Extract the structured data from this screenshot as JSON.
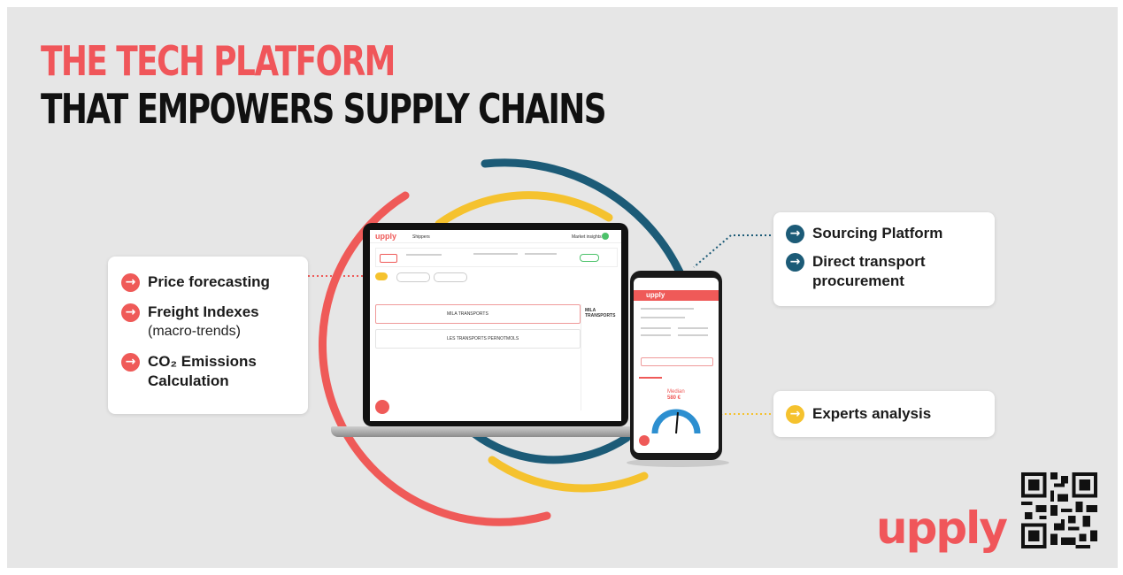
{
  "header": {
    "title_line1": "THE TECH PLATFORM",
    "title_line2": "THAT EMPOWERS SUPPLY CHAINS"
  },
  "left_card": {
    "items": [
      {
        "label": "Price forecasting",
        "sub": ""
      },
      {
        "label": "Freight Indexes",
        "sub": "(macro-trends)"
      },
      {
        "label": "CO₂ Emissions",
        "sub": "Calculation"
      }
    ]
  },
  "right_top_card": {
    "items": [
      {
        "label": "Sourcing Platform"
      },
      {
        "label": "Direct transport procurement"
      }
    ]
  },
  "right_bottom_card": {
    "items": [
      {
        "label": "Experts analysis"
      }
    ]
  },
  "laptop": {
    "logo": "upply",
    "tab": "Shippers",
    "menu": "Market insights",
    "offer_company_1": "MILA TRANSPORTS",
    "offer_company_2": "LES TRANSPORTS PERNOTMOLS",
    "detail_title": "MILA TRANSPORTS"
  },
  "phone": {
    "logo": "upply",
    "gauge_label": "Median",
    "gauge_value": "580 €"
  },
  "brand": {
    "logo": "upply"
  },
  "colors": {
    "accent_red": "#f0565a",
    "accent_blue": "#1c5b77",
    "accent_yellow": "#f5c22e",
    "background": "#e6e6e6"
  },
  "icons": [
    "arrow-right-icon",
    "qr-code-icon"
  ]
}
